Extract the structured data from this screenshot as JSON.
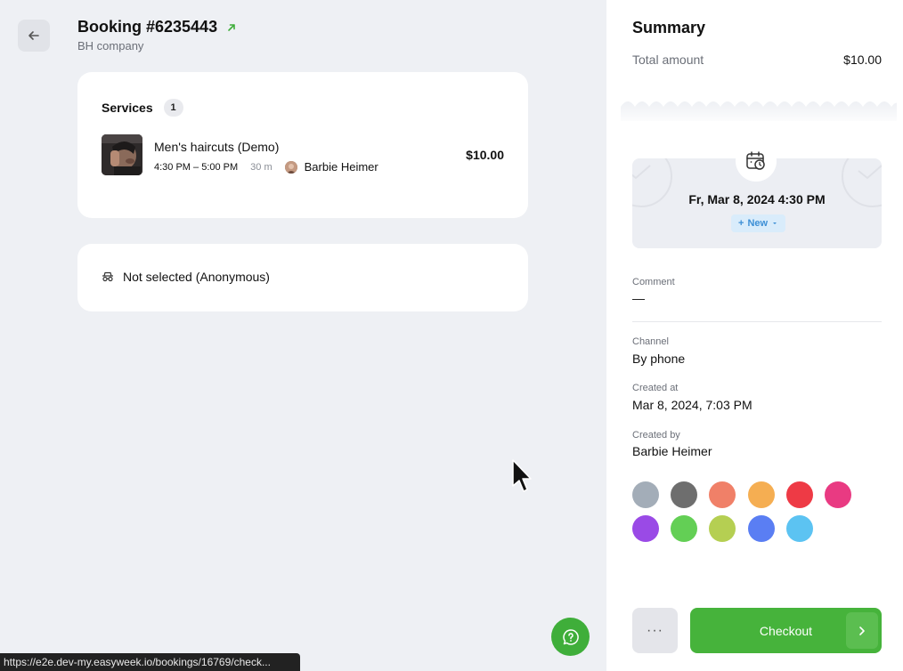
{
  "header": {
    "title": "Booking #6235443",
    "company": "BH company"
  },
  "services": {
    "title": "Services",
    "count": "1",
    "items": [
      {
        "name": "Men's haircuts (Demo)",
        "time": "4:30 PM – 5:00 PM",
        "duration": "30 m",
        "staff": "Barbie Heimer",
        "price": "$10.00"
      }
    ]
  },
  "client": {
    "label": "Not selected (Anonymous)"
  },
  "summary": {
    "title": "Summary",
    "total_label": "Total amount",
    "total_value": "$10.00",
    "date": "Fr, Mar 8, 2024 4:30 PM",
    "status": "New",
    "comment_label": "Comment",
    "comment_value": "—",
    "channel_label": "Channel",
    "channel_value": "By phone",
    "created_at_label": "Created at",
    "created_at_value": "Mar 8, 2024, 7:03 PM",
    "created_by_label": "Created by",
    "created_by_value": "Barbie Heimer"
  },
  "colors": [
    "#a3adb8",
    "#6e6e6e",
    "#f08068",
    "#f5ae52",
    "#ee3a45",
    "#e93a82",
    "#9a4ae6",
    "#63cf55",
    "#b5cf52",
    "#5a7ef3",
    "#5cc3f2"
  ],
  "actions": {
    "more_label": "···",
    "checkout_label": "Checkout"
  },
  "status_bar": {
    "url": "https://e2e.dev-my.easyweek.io/bookings/16769/check..."
  },
  "theme": {
    "accent": "#46b33b",
    "background": "#eef0f4"
  }
}
